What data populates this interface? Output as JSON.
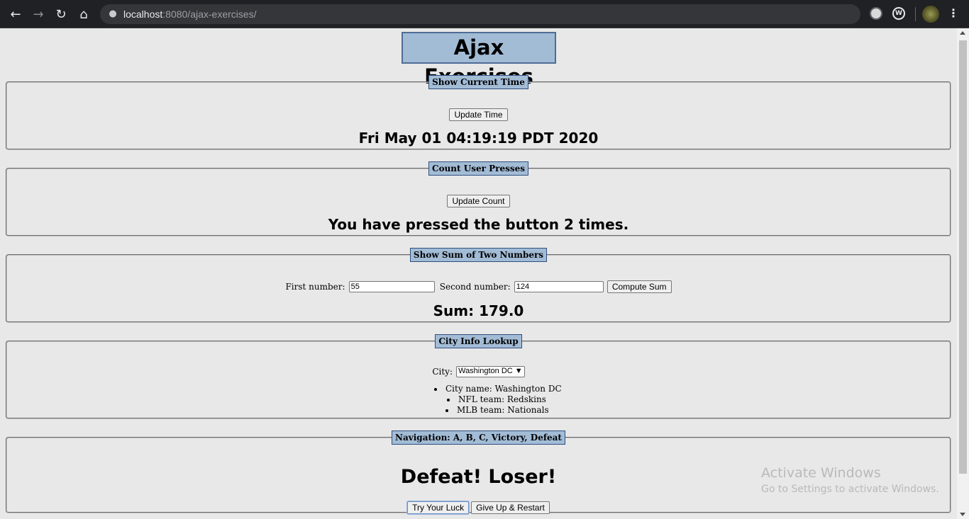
{
  "browser": {
    "url_host": "localhost",
    "url_rest": ":8080/ajax-exercises/"
  },
  "page_title": "Ajax Exercises",
  "time_panel": {
    "legend": "Show Current Time",
    "button": "Update Time",
    "result": "Fri May 01 04:19:19 PDT 2020"
  },
  "count_panel": {
    "legend": "Count User Presses",
    "button": "Update Count",
    "result": "You have pressed the button 2 times."
  },
  "sum_panel": {
    "legend": "Show Sum of Two Numbers",
    "first_label": "First number:",
    "first_value": "55",
    "second_label": "Second number:",
    "second_value": "124",
    "button": "Compute Sum",
    "result": "Sum: 179.0"
  },
  "city_panel": {
    "legend": "City Info Lookup",
    "city_label": "City:",
    "city_selected": "Washington DC",
    "items": [
      "City name: Washington DC",
      "NFL team: Redskins",
      "MLB team: Nationals"
    ]
  },
  "nav_panel": {
    "legend": "Navigation: A, B, C, Victory, Defeat",
    "result": "Defeat! Loser!",
    "button_try": "Try Your Luck",
    "button_restart": "Give Up & Restart"
  },
  "watermark": {
    "line1": "Activate Windows",
    "line2": "Go to Settings to activate Windows."
  }
}
